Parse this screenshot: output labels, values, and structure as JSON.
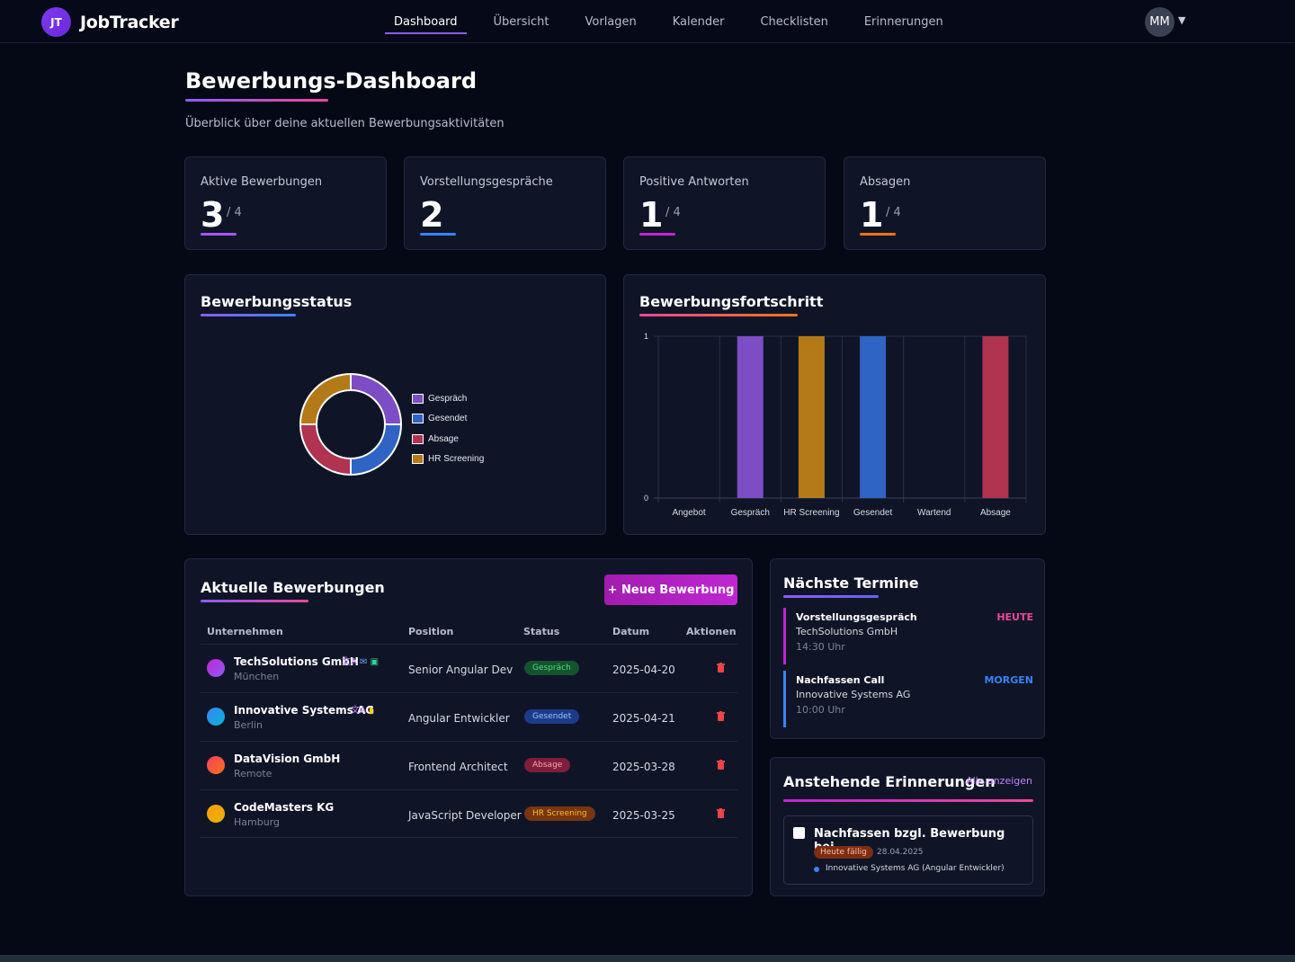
{
  "app": {
    "logo_initials": "JT",
    "name": "JobTracker"
  },
  "nav": {
    "items": [
      "Dashboard",
      "Übersicht",
      "Vorlagen",
      "Kalender",
      "Checklisten",
      "Erinnerungen"
    ],
    "active": "Dashboard",
    "user_initials": "MM"
  },
  "header": {
    "title": "Bewerbungs-Dashboard",
    "subtitle": "Überblick über deine aktuellen Bewerbungsaktivitäten"
  },
  "stats": [
    {
      "label": "Aktive Bewerbungen",
      "value": "3",
      "total": "/ 4",
      "color": "#a855f7"
    },
    {
      "label": "Vorstellungsgespräche",
      "value": "2",
      "total": "",
      "color": "#3b82f6"
    },
    {
      "label": "Positive Antworten",
      "value": "1",
      "total": "/ 4",
      "color": "#c026d3"
    },
    {
      "label": "Absagen",
      "value": "1",
      "total": "/ 4",
      "color": "#f97316"
    }
  ],
  "status_panel": {
    "title": "Bewerbungsstatus"
  },
  "progress_panel": {
    "title": "Bewerbungsfortschritt"
  },
  "chart_data": [
    {
      "type": "pie",
      "title": "Bewerbungsstatus",
      "donut": true,
      "categories": [
        "Gespräch",
        "Gesendet",
        "Absage",
        "HR Screening"
      ],
      "values": [
        1,
        1,
        1,
        1
      ],
      "colors": [
        "#7c4dc4",
        "#2f63c4",
        "#b03350",
        "#b47a17"
      ],
      "legend": "right"
    },
    {
      "type": "bar",
      "title": "Bewerbungsfortschritt",
      "categories": [
        "Angebot",
        "Gespräch",
        "HR Screening",
        "Gesendet",
        "Wartend",
        "Absage"
      ],
      "values": [
        0,
        1,
        1,
        1,
        0,
        1
      ],
      "colors": [
        "#7c4dc4",
        "#7c4dc4",
        "#b47a17",
        "#2f63c4",
        "#7c4dc4",
        "#b03350"
      ],
      "ylim": [
        0,
        1
      ],
      "yticks": [
        "0",
        "1"
      ],
      "grid": true
    }
  ],
  "applications": {
    "title": "Aktuelle Bewerbungen",
    "new_button": "+ Neue Bewerbung",
    "columns": [
      "Unternehmen",
      "Position",
      "Status",
      "Datum",
      "Aktionen"
    ],
    "rows": [
      {
        "company": "TechSolutions GmbH",
        "city": "München",
        "position": "Senior Angular Dev",
        "status": "Gespräch",
        "date": "2025-04-20",
        "dot": "#c026d3",
        "icons": [
          "translate-icon",
          "mail-icon",
          "document-icon"
        ]
      },
      {
        "company": "Innovative Systems AG",
        "city": "Berlin",
        "position": "Angular Entwickler",
        "status": "Gesendet",
        "date": "2025-04-21",
        "dot": "#3b82f6",
        "icons": [
          "translate-icon",
          "clipboard-icon"
        ]
      },
      {
        "company": "DataVision GmbH",
        "city": "Remote",
        "position": "Frontend Architect",
        "status": "Absage",
        "date": "2025-03-28",
        "dot": "#f43f5e",
        "icons": []
      },
      {
        "company": "CodeMasters KG",
        "city": "Hamburg",
        "position": "JavaScript Developer",
        "status": "HR Screening",
        "date": "2025-03-25",
        "dot": "#f59e0b",
        "icons": []
      }
    ]
  },
  "appointments": {
    "title": "Nächste Termine",
    "items": [
      {
        "title": "Vorstellungsgespräch",
        "company": "TechSolutions GmbH",
        "time": "14:30 Uhr",
        "tag": "HEUTE",
        "tag_color": "#ec4899",
        "border": "#c026d3"
      },
      {
        "title": "Nachfassen Call",
        "company": "Innovative Systems AG",
        "time": "10:00 Uhr",
        "tag": "MORGEN",
        "tag_color": "#3b82f6",
        "border": "#3b82f6"
      }
    ]
  },
  "reminders": {
    "title": "Anstehende Erinnerungen",
    "show_all": "Alle anzeigen",
    "items": [
      {
        "title": "Nachfassen bzgl. Bewerbung bei...",
        "due": "Heute fällig",
        "date": "28.04.2025",
        "company": "Innovative Systems AG (Angular Entwickler)"
      }
    ]
  }
}
